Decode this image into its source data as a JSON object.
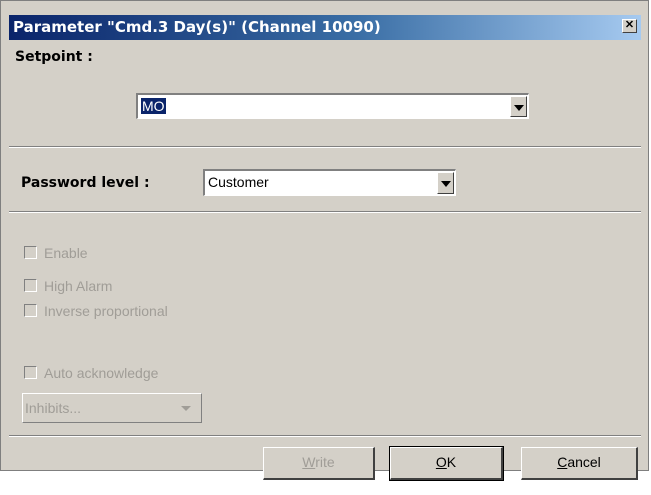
{
  "dialog": {
    "title": "Parameter \"Cmd.3 Day(s)\" (Channel 10090)",
    "close_glyph": "✕"
  },
  "setpoint": {
    "label": "Setpoint :",
    "value": "MO"
  },
  "password": {
    "label": "Password level :",
    "value": "Customer"
  },
  "checkboxes": {
    "enable": "Enable",
    "high_alarm": "High Alarm",
    "inverse": "Inverse proportional",
    "auto_ack": "Auto acknowledge"
  },
  "inhibits": {
    "label": "Inhibits..."
  },
  "buttons": {
    "write_mnemonic": "W",
    "write_rest": "rite",
    "ok_mnemonic": "O",
    "ok_rest": "K",
    "cancel_mnemonic": "C",
    "cancel_rest": "ancel"
  }
}
